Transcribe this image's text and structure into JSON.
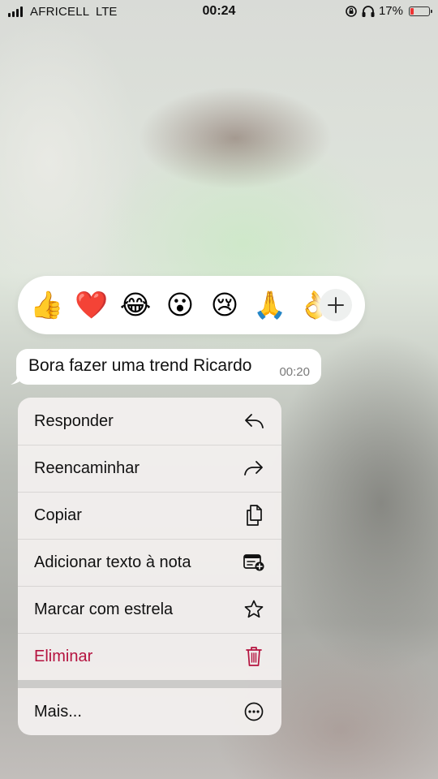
{
  "status_bar": {
    "carrier": "AFRICELL",
    "network": "LTE",
    "time": "00:24",
    "battery": "17%",
    "battery_color": "#e33333"
  },
  "reactions": {
    "emojis": [
      {
        "name": "thumbs-up",
        "glyph": "👍"
      },
      {
        "name": "red-heart",
        "glyph": "❤️"
      },
      {
        "name": "tears-of-joy",
        "glyph": "😂"
      },
      {
        "name": "surprised-face",
        "glyph": "😮"
      },
      {
        "name": "crying-face",
        "glyph": "😢"
      },
      {
        "name": "folded-hands",
        "glyph": "🙏"
      },
      {
        "name": "ok-hand",
        "glyph": "👌"
      }
    ],
    "more_icon": "plus-icon"
  },
  "message": {
    "text": "Bora fazer uma trend Ricardo",
    "time": "00:20"
  },
  "menu": {
    "items": [
      {
        "label": "Responder",
        "icon": "reply-icon"
      },
      {
        "label": "Reencaminhar",
        "icon": "forward-icon"
      },
      {
        "label": "Copiar",
        "icon": "copy-icon"
      },
      {
        "label": "Adicionar texto à nota",
        "icon": "add-note-icon"
      },
      {
        "label": "Marcar com estrela",
        "icon": "star-icon"
      },
      {
        "label": "Eliminar",
        "icon": "trash-icon",
        "color": "#b5133f"
      },
      {
        "label": "Mais...",
        "icon": "more-icon"
      }
    ]
  }
}
